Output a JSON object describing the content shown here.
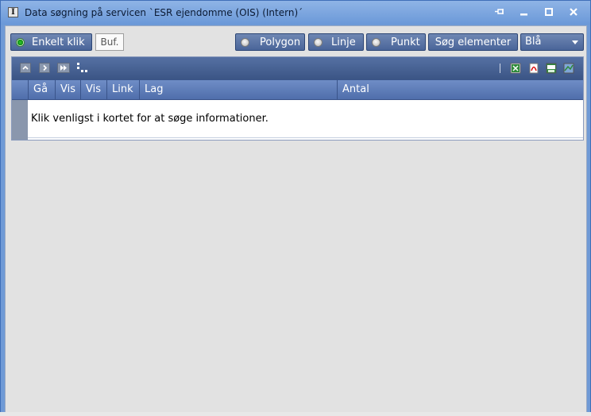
{
  "window": {
    "title": "Data søgning på servicen `ESR ejendomme (OIS) (Intern)´",
    "app_icon_glyph": "I",
    "controls": {
      "pin": "pin-icon",
      "minimize": "minimize-icon",
      "maximize": "maximize-icon",
      "close": "close-icon"
    }
  },
  "toolbar": {
    "single_click_label": "Enkelt klik",
    "buffer_label": "Buf.",
    "polygon_label": "Polygon",
    "line_label": "Linje",
    "point_label": "Punkt",
    "search_elements_label": "Søg elementer",
    "color_select_value": "Blå"
  },
  "results": {
    "nav_icons": [
      "collapse-up-icon",
      "next-icon",
      "last-icon",
      "tree-icon"
    ],
    "export_icons": [
      "excel-export-icon",
      "pdf-export-icon",
      "csv-export-icon",
      "map-export-icon"
    ],
    "columns": [
      "Gå",
      "Vis",
      "Vis",
      "Link",
      "Lag",
      "Antal"
    ],
    "message": "Klik venligst i kortet for at søge informationer."
  },
  "colors": {
    "titlebar": "#7ea6df",
    "button": "#56709f",
    "grid_header": "#5d7bb6",
    "active_radio": "#1aa81a"
  }
}
